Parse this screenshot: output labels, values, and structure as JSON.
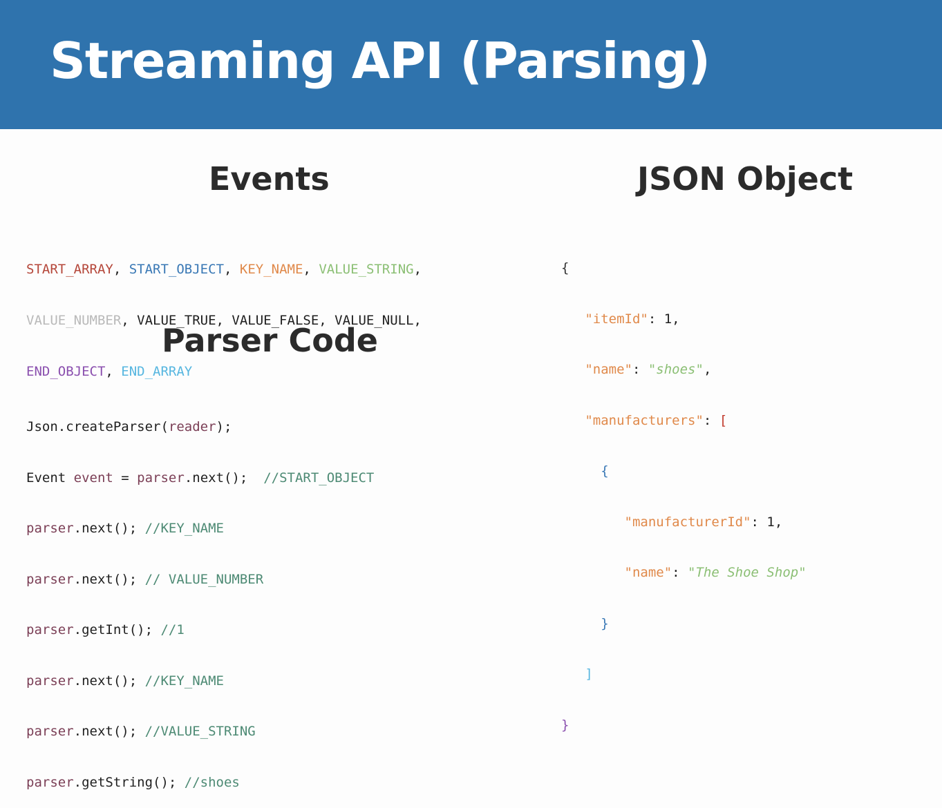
{
  "title": "Streaming API (Parsing)",
  "events_heading": "Events",
  "json_heading": "JSON Object",
  "parser_heading": "Parser Code",
  "events": {
    "line1": [
      "START_ARRAY",
      ", ",
      "START_OBJECT",
      ", ",
      "KEY_NAME",
      ", ",
      "VALUE_STRING",
      ","
    ],
    "line2": [
      "VALUE_NUMBER",
      ", VALUE_TRUE, VALUE_FALSE, VALUE_NULL,"
    ],
    "line3": [
      "END_OBJECT",
      ", ",
      "END_ARRAY"
    ]
  },
  "parser_code": [
    {
      "code": "Json.createParser(",
      "var": "reader",
      "tail": ");",
      "comment": ""
    },
    {
      "code": "Event ",
      "var": "event",
      "tail": " = ",
      "var2": "parser",
      "tail2": ".next();  ",
      "comment": "//START_OBJECT"
    },
    {
      "var": "parser",
      "tail": ".next(); ",
      "comment": "//KEY_NAME"
    },
    {
      "var": "parser",
      "tail": ".next(); ",
      "comment": "// VALUE_NUMBER"
    },
    {
      "var": "parser",
      "tail": ".getInt(); ",
      "comment": "//1"
    },
    {
      "var": "parser",
      "tail": ".next(); ",
      "comment": "//KEY_NAME"
    },
    {
      "var": "parser",
      "tail": ".next(); ",
      "comment": "//VALUE_STRING"
    },
    {
      "var": "parser",
      "tail": ".getString(); ",
      "comment": "//shoes"
    }
  ],
  "json_object": {
    "open": "{",
    "key_itemId": "\"itemId\"",
    "val_itemId": ": 1,",
    "key_name": "\"name\"",
    "val_name": "\"shoes\"",
    "key_manufacturers": "\"manufacturers\"",
    "inner_open": "{",
    "key_manufacturerId": "\"manufacturerId\"",
    "val_manufacturerId": ": 1,",
    "key_name2": "\"name\"",
    "val_name2": "\"The Shoe Shop\"",
    "inner_close": "}",
    "array_close": "]",
    "close": "}"
  }
}
